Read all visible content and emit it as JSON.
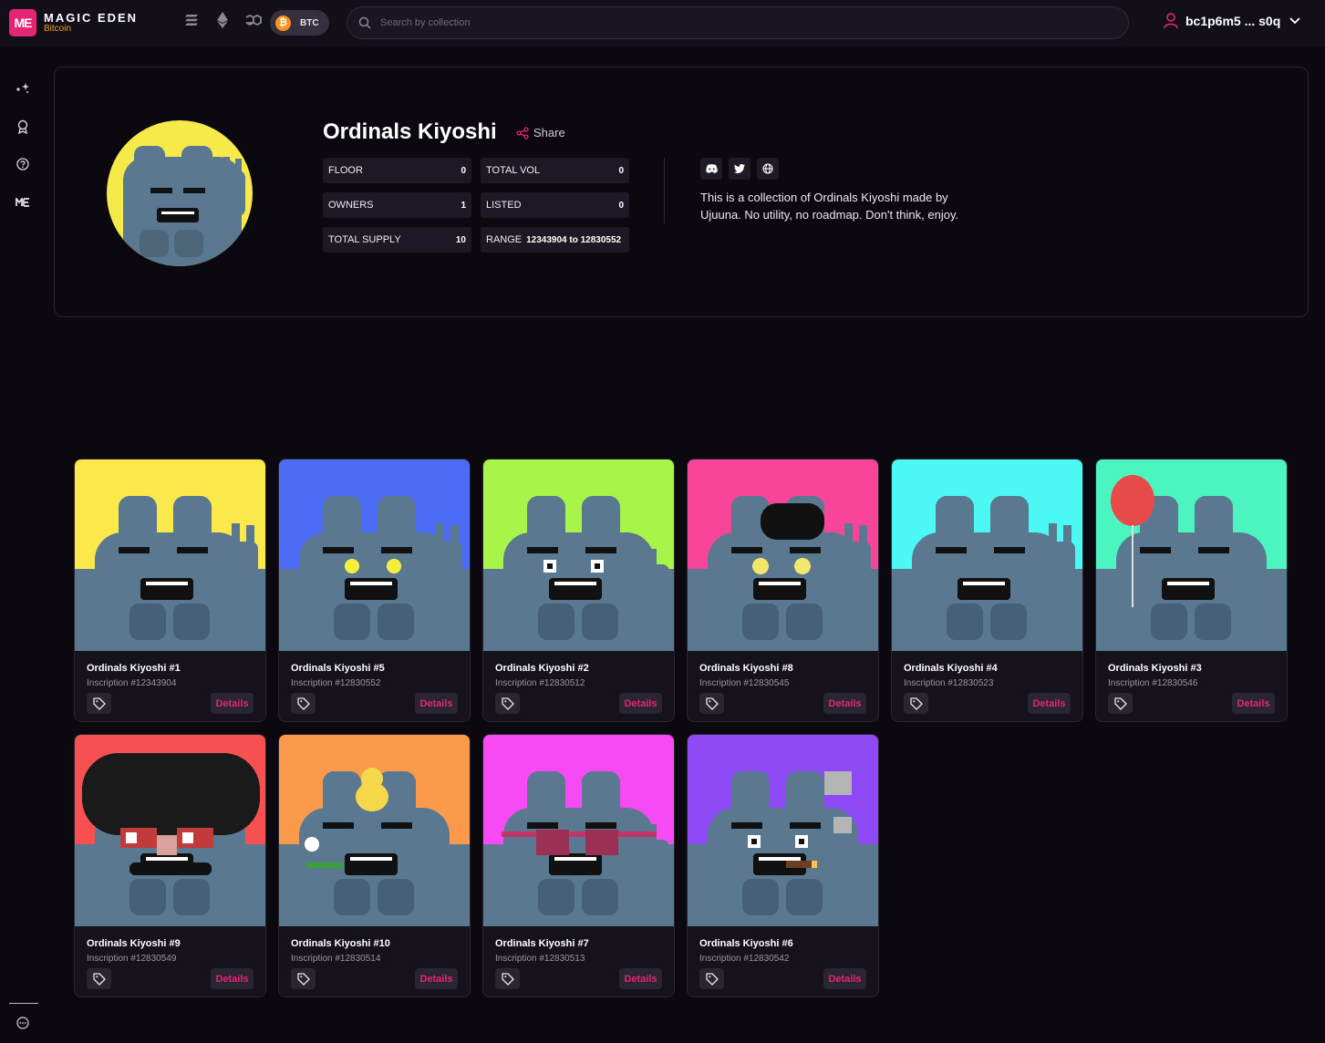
{
  "brand": {
    "title": "MAGIC EDEN",
    "subtitle": "Bitcoin",
    "mark": "ME",
    "accent": "#e42575"
  },
  "nav": {
    "chains": [
      {
        "name": "solana-icon"
      },
      {
        "name": "ethereum-icon"
      },
      {
        "name": "polygon-icon"
      }
    ],
    "active_chain": "BTC",
    "search_placeholder": "Search by collection",
    "wallet": "bc1p6m5 ... s0q"
  },
  "sidebar": [
    "sparkle-icon",
    "award-icon",
    "help-icon",
    "me-logo-icon"
  ],
  "collection": {
    "title": "Ordinals Kiyoshi",
    "share_label": "Share",
    "stats": [
      {
        "label": "FLOOR",
        "value": "0"
      },
      {
        "label": "TOTAL VOL",
        "value": "0"
      },
      {
        "label": "OWNERS",
        "value": "1"
      },
      {
        "label": "LISTED",
        "value": "0"
      },
      {
        "label": "TOTAL SUPPLY",
        "value": "10"
      },
      {
        "label": "RANGE",
        "value": "12343904 to 12830552"
      }
    ],
    "description": "This is a collection of Ordinals Kiyoshi made by Ujuuna. No utility, no roadmap. Don't think, enjoy."
  },
  "details_label": "Details",
  "items": [
    {
      "name": "Ordinals Kiyoshi #1",
      "inscription": "Inscription #12343904",
      "bg": "#fbe94c",
      "trait": "peace"
    },
    {
      "name": "Ordinals Kiyoshi #5",
      "inscription": "Inscription #12830552",
      "bg": "#4c6cf6",
      "trait": "stareyes"
    },
    {
      "name": "Ordinals Kiyoshi #2",
      "inscription": "Inscription #12830512",
      "bg": "#a8f54a",
      "trait": "thumb"
    },
    {
      "name": "Ordinals Kiyoshi #8",
      "inscription": "Inscription #12830545",
      "bg": "#f8459a",
      "trait": "beret"
    },
    {
      "name": "Ordinals Kiyoshi #4",
      "inscription": "Inscription #12830523",
      "bg": "#4cf8f4",
      "trait": "peace"
    },
    {
      "name": "Ordinals Kiyoshi #3",
      "inscription": "Inscription #12830546",
      "bg": "#4cf5c0",
      "trait": "balloon"
    },
    {
      "name": "Ordinals Kiyoshi #9",
      "inscription": "Inscription #12830549",
      "bg": "#f65050",
      "trait": "afro"
    },
    {
      "name": "Ordinals Kiyoshi #10",
      "inscription": "Inscription #12830514",
      "bg": "#fb9a4a",
      "trait": "duck"
    },
    {
      "name": "Ordinals Kiyoshi #7",
      "inscription": "Inscription #12830513",
      "bg": "#f84af4",
      "trait": "glasses"
    },
    {
      "name": "Ordinals Kiyoshi #6",
      "inscription": "Inscription #12830542",
      "bg": "#8e4af4",
      "trait": "cigar"
    }
  ]
}
